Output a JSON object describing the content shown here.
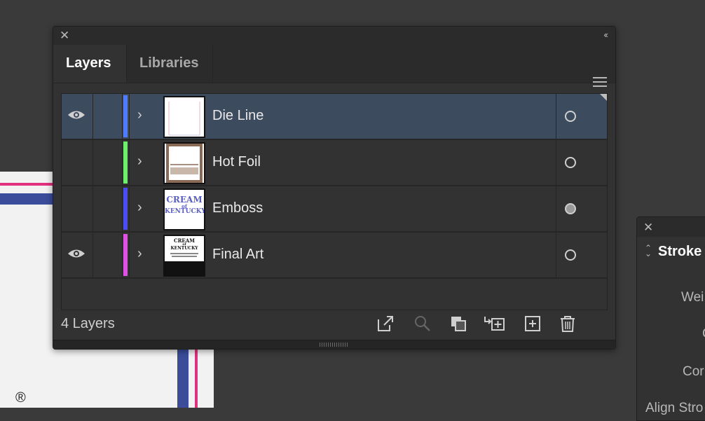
{
  "canvas": {
    "registered_mark": "®"
  },
  "layers_panel": {
    "tabs": [
      {
        "label": "Layers",
        "active": true
      },
      {
        "label": "Libraries",
        "active": false
      }
    ],
    "layers": [
      {
        "name": "Die Line",
        "visible": true,
        "selected": true,
        "color": "#4f7cff",
        "target": "hollow"
      },
      {
        "name": "Hot Foil",
        "visible": false,
        "selected": false,
        "color": "#6cf06a",
        "target": "hollow"
      },
      {
        "name": "Emboss",
        "visible": false,
        "selected": false,
        "color": "#4a4df2",
        "target": "filled"
      },
      {
        "name": "Final Art",
        "visible": true,
        "selected": false,
        "color": "#e04fe6",
        "target": "hollow"
      }
    ],
    "footer": {
      "count_label": "4 Layers"
    },
    "thumbs": {
      "emboss_text": [
        "CREAM",
        "of",
        "KENTUCKY"
      ],
      "final_art_text": [
        "CREAM",
        "of",
        "KENTUCKY"
      ]
    }
  },
  "stroke_panel": {
    "title": "Stroke",
    "labels": [
      "Wei",
      "C",
      "Cor",
      "Align Stro"
    ]
  }
}
